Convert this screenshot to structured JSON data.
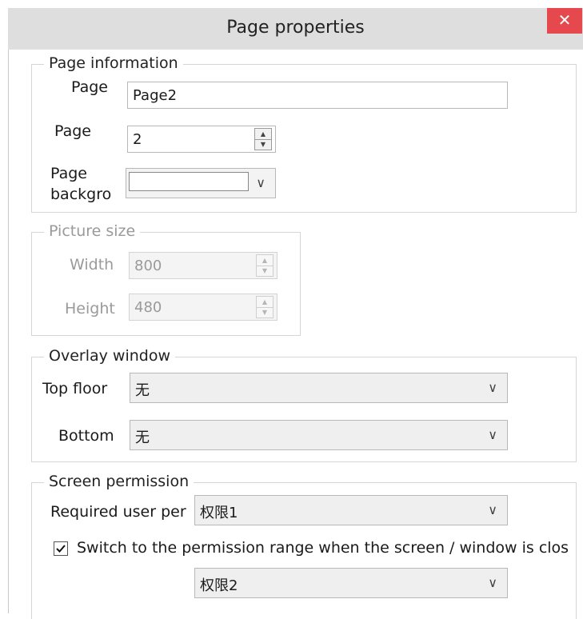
{
  "window": {
    "title": "Page properties",
    "close_glyph": "✕"
  },
  "page_information": {
    "legend": "Page information",
    "page_name_label": "Page",
    "page_name_value": "Page2",
    "page_number_label": "Page",
    "page_number_value": "2",
    "background_label_line1": "Page",
    "background_label_line2": "backgro",
    "background_color": "#ffffff"
  },
  "picture_size": {
    "legend": "Picture size",
    "width_label": "Width",
    "width_value": "800",
    "height_label": "Height",
    "height_value": "480"
  },
  "overlay_window": {
    "legend": "Overlay window",
    "top_floor_label": "Top floor",
    "top_floor_value": "无",
    "bottom_label": "Bottom",
    "bottom_value": "无"
  },
  "screen_permission": {
    "legend": "Screen permission",
    "required_label": "Required user per",
    "required_value": "权限1",
    "switch_checked": true,
    "switch_label": "Switch to the permission range when the screen / window is clos",
    "switch_value": "权限2"
  },
  "colors": {
    "close_bg": "#e5484d",
    "titlebar_bg": "#dedede"
  }
}
